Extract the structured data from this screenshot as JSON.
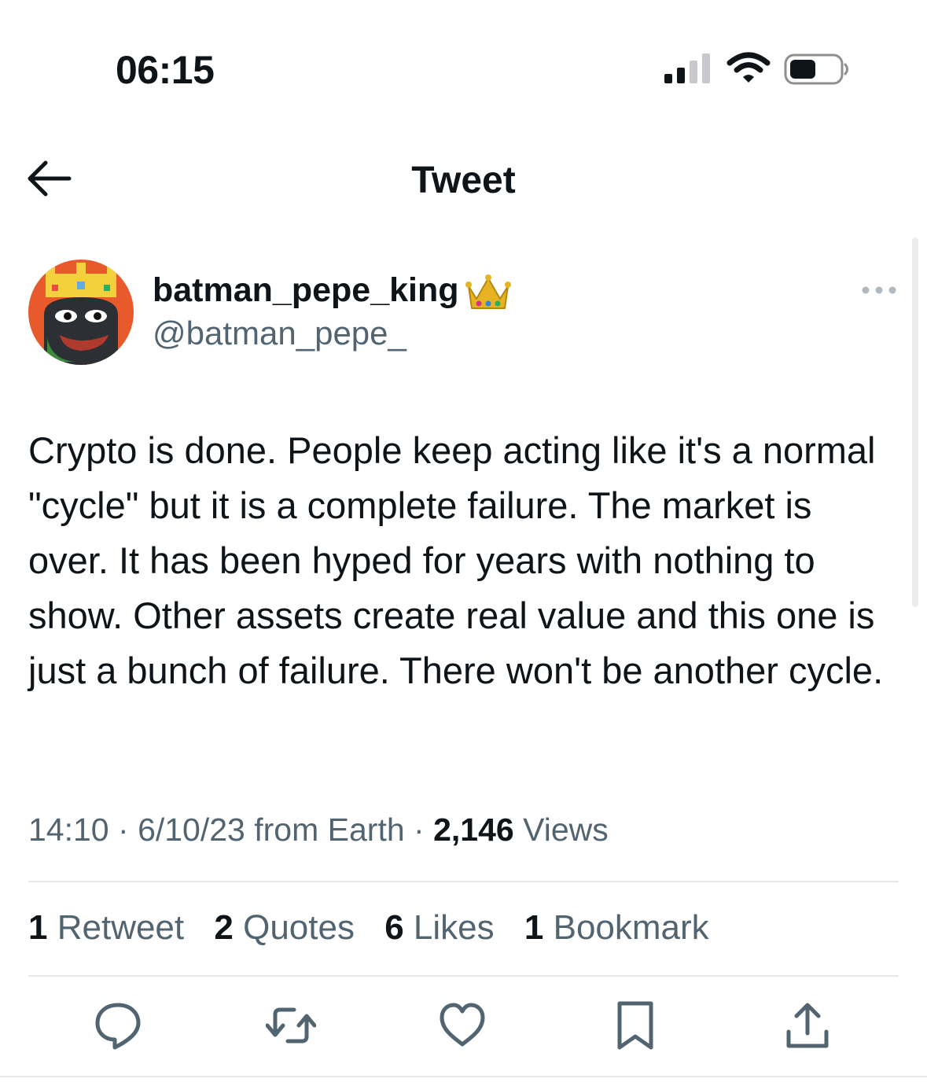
{
  "status_bar": {
    "time": "06:15",
    "icons": [
      "cellular-signal-icon",
      "wifi-icon",
      "battery-icon"
    ]
  },
  "nav": {
    "title": "Tweet",
    "back_icon": "arrow-left-icon"
  },
  "tweet": {
    "display_name": "batman_pepe_king",
    "name_emoji": "crown-icon",
    "handle": "@batman_pepe_",
    "more_icon": "ellipsis-icon",
    "text": "Crypto is done. People keep acting like it's a normal \"cycle\" but it is a complete failure. The market is over. It has been hyped for years with nothing to show. Other assets create real value and this one is just a bunch of failure. There won't be another cycle.",
    "meta": {
      "time": "14:10",
      "date_source": "6/10/23 from Earth",
      "views_count": "2,146",
      "views_label": "Views"
    },
    "stats": {
      "retweets_count": "1",
      "retweets_label": "Retweet",
      "quotes_count": "2",
      "quotes_label": "Quotes",
      "likes_count": "6",
      "likes_label": "Likes",
      "bookmarks_count": "1",
      "bookmarks_label": "Bookmark"
    },
    "actions": [
      "reply-icon",
      "retweet-icon",
      "like-icon",
      "bookmark-icon",
      "share-icon"
    ]
  },
  "colors": {
    "text": "#0f1419",
    "secondary": "#536471",
    "divider": "#e6e9ec",
    "avatar_bg": "#e85a2c"
  }
}
